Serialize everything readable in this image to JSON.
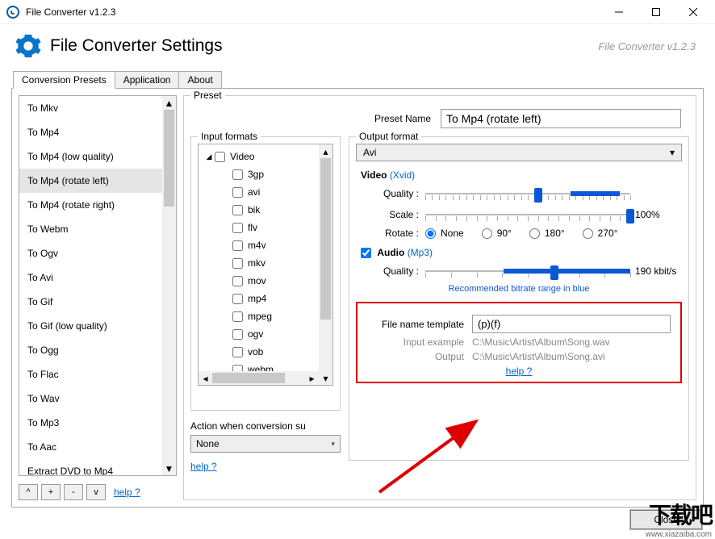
{
  "window": {
    "title": "File Converter v1.2.3"
  },
  "header": {
    "title": "File Converter Settings",
    "version": "File Converter v1.2.3"
  },
  "tabs": {
    "t0": "Conversion Presets",
    "t1": "Application",
    "t2": "About"
  },
  "presets": {
    "items": [
      "To Mkv",
      "To Mp4",
      "To Mp4 (low quality)",
      "To Mp4 (rotate left)",
      "To Mp4 (rotate right)",
      "To Webm",
      "To Ogv",
      "To Avi",
      "To Gif",
      "To Gif (low quality)",
      "To Ogg",
      "To Flac",
      "To Wav",
      "To Mp3",
      "To Aac",
      "Extract DVD to Mp4"
    ],
    "selected_index": 3,
    "buttons": {
      "up": "^",
      "add": "+",
      "remove": "-",
      "down": "v"
    },
    "help": "help ?"
  },
  "preset_panel": {
    "legend": "Preset",
    "name_label": "Preset Name",
    "name_value": "To Mp4 (rotate left)"
  },
  "input_formats": {
    "legend": "Input formats",
    "root": "Video",
    "children": [
      "3gp",
      "avi",
      "bik",
      "flv",
      "m4v",
      "mkv",
      "mov",
      "mp4",
      "mpeg",
      "ogv",
      "vob",
      "webm"
    ]
  },
  "action": {
    "label": "Action when conversion su",
    "value": "None",
    "help": "help ?"
  },
  "output": {
    "legend": "Output format",
    "format": "Avi",
    "video": {
      "label": "Video",
      "codec": "(Xvid)",
      "quality_label": "Quality :",
      "scale_label": "Scale :",
      "scale_value": "100%",
      "rotate_label": "Rotate :",
      "rotate_options": [
        "None",
        "90°",
        "180°",
        "270°"
      ],
      "rotate_selected": 0
    },
    "audio": {
      "label": "Audio",
      "codec": "(Mp3)",
      "checked": true,
      "quality_label": "Quality :",
      "quality_value": "190 kbit/s"
    },
    "rec_note": "Recommended bitrate range in blue",
    "filename": {
      "template_label": "File name template",
      "template_value": "(p)(f)",
      "input_example_label": "Input example",
      "input_example_value": "C:\\Music\\Artist\\Album\\Song.wav",
      "output_label": "Output",
      "output_value": "C:\\Music\\Artist\\Album\\Song.avi",
      "help": "help ?"
    }
  },
  "footer": {
    "close": "Close"
  },
  "watermark": {
    "big": "下载吧",
    "url": "www.xiazaiba.com"
  }
}
